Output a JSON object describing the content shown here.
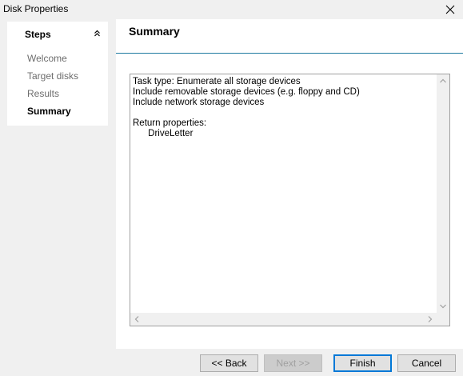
{
  "window": {
    "title": "Disk Properties"
  },
  "steps": {
    "header": "Steps",
    "items": [
      {
        "label": "Welcome",
        "state": "done"
      },
      {
        "label": "Target disks",
        "state": "done"
      },
      {
        "label": "Results",
        "state": "done"
      },
      {
        "label": "Summary",
        "state": "current"
      }
    ]
  },
  "page": {
    "title": "Summary",
    "summary_text": "Task type: Enumerate all storage devices\nInclude removable storage devices (e.g. floppy and CD)\nInclude network storage devices\n\nReturn properties:\n      DriveLetter"
  },
  "buttons": {
    "back": "<< Back",
    "next": "Next >>",
    "finish": "Finish",
    "cancel": "Cancel"
  },
  "colors": {
    "accent_rule": "#1e7aa0",
    "default_button_border": "#0078d7"
  }
}
